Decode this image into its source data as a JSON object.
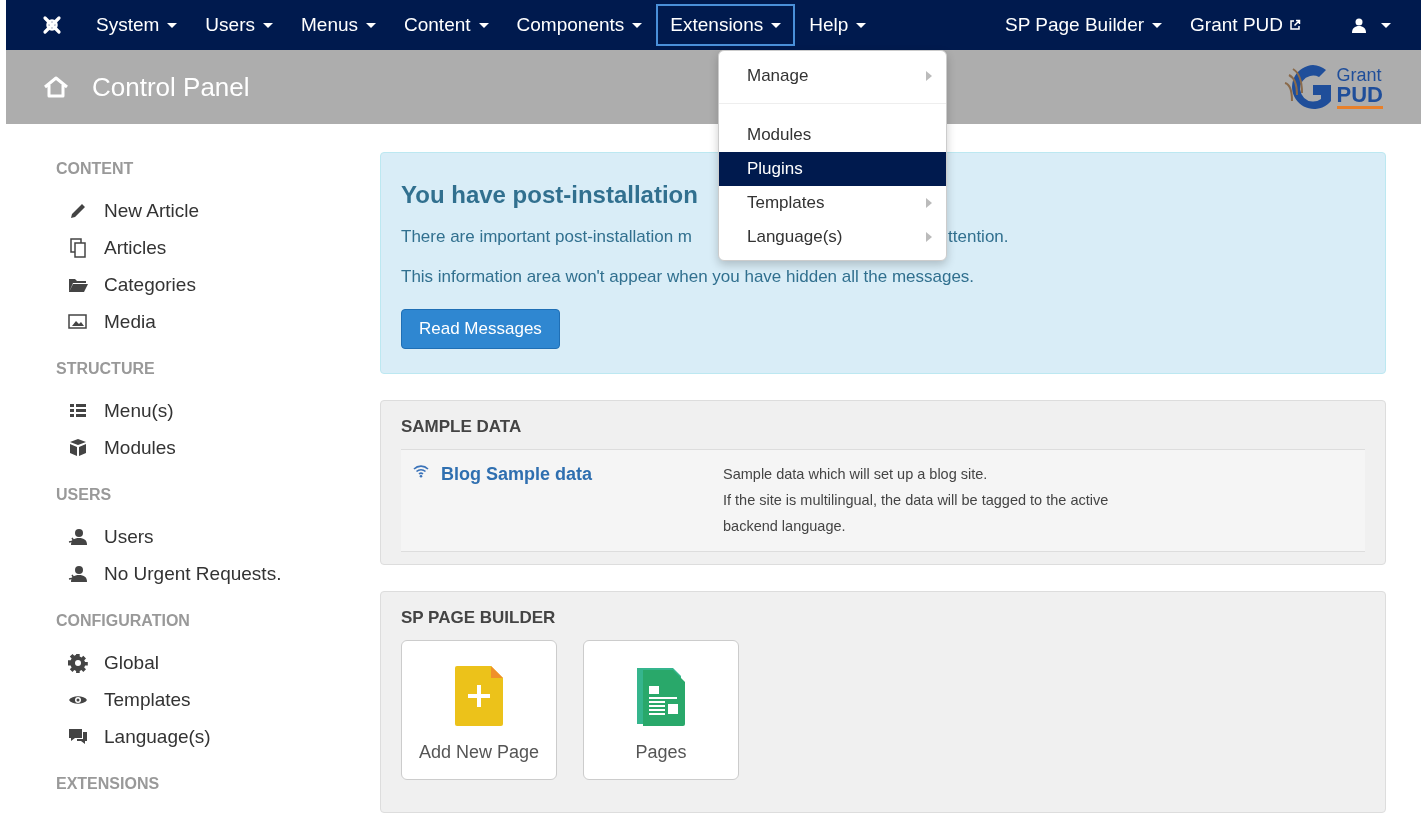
{
  "navbar": {
    "items": [
      {
        "kind": "menu",
        "label": "System",
        "selected": false
      },
      {
        "kind": "menu",
        "label": "Users",
        "selected": false
      },
      {
        "kind": "menu",
        "label": "Menus",
        "selected": false
      },
      {
        "kind": "menu",
        "label": "Content",
        "selected": false
      },
      {
        "kind": "menu",
        "label": "Components",
        "selected": false
      },
      {
        "kind": "menu",
        "label": "Extensions",
        "selected": true
      },
      {
        "kind": "menu",
        "label": "Help",
        "selected": false
      }
    ],
    "right": [
      {
        "kind": "menu",
        "label": "SP Page Builder"
      },
      {
        "kind": "external",
        "label": "Grant PUD"
      },
      {
        "kind": "user"
      }
    ]
  },
  "dropdown": {
    "items": [
      {
        "kind": "item",
        "label": "Manage",
        "submenu": true,
        "selected": false
      },
      {
        "kind": "divider"
      },
      {
        "kind": "item",
        "label": "Modules",
        "submenu": false,
        "selected": false
      },
      {
        "kind": "item",
        "label": "Plugins",
        "submenu": false,
        "selected": true
      },
      {
        "kind": "item",
        "label": "Templates",
        "submenu": true,
        "selected": false
      },
      {
        "kind": "item",
        "label": "Language(s)",
        "submenu": true,
        "selected": false
      }
    ]
  },
  "header": {
    "title": "Control Panel",
    "logo": {
      "top": "Grant",
      "bottom": "PUD"
    }
  },
  "sidebar": {
    "sections": [
      {
        "heading": "CONTENT",
        "items": [
          "New Article",
          "Articles",
          "Categories",
          "Media"
        ]
      },
      {
        "heading": "STRUCTURE",
        "items": [
          "Menu(s)",
          "Modules"
        ]
      },
      {
        "heading": "USERS",
        "items": [
          "Users",
          "No Urgent Requests."
        ]
      },
      {
        "heading": "CONFIGURATION",
        "items": [
          "Global",
          "Templates",
          "Language(s)"
        ]
      },
      {
        "heading": "EXTENSIONS"
      }
    ]
  },
  "alert": {
    "heading": "You have post-installation",
    "line_1_start": "There are important post-installation m",
    "line_1_end": "ttention.",
    "line_2": "This information area won't appear when you have hidden all the messages.",
    "button": "Read Messages"
  },
  "sample_data": {
    "title": "SAMPLE DATA",
    "rows": [
      {
        "link": "Blog Sample data",
        "description": [
          "Sample data which will set up a blog site.",
          "If the site is multilingual, the data will be tagged to the active backend language."
        ]
      }
    ]
  },
  "page_builder": {
    "title": "SP PAGE BUILDER",
    "tiles": [
      {
        "kind": "add",
        "label": "Add New Page"
      },
      {
        "kind": "pages",
        "label": "Pages"
      }
    ]
  }
}
